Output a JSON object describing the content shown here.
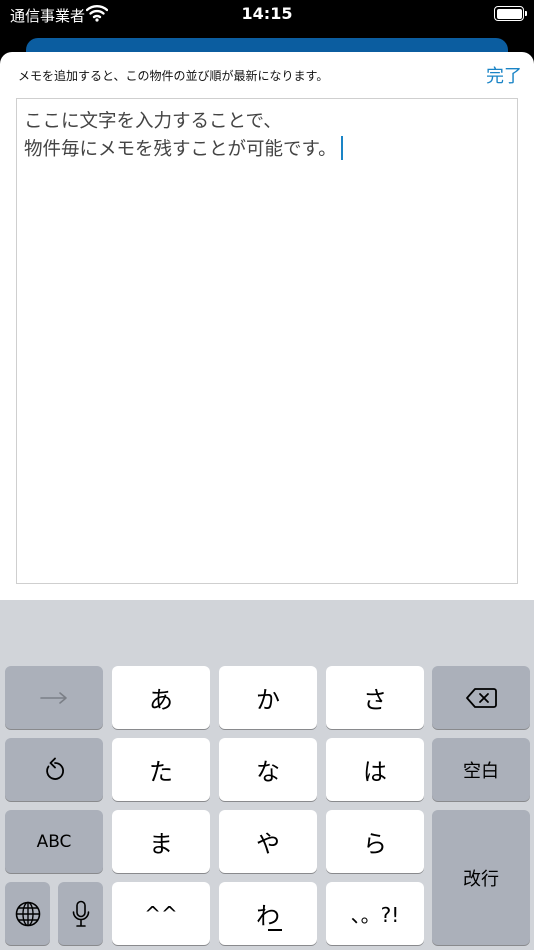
{
  "status_bar": {
    "carrier": "通信事業者",
    "time": "14:15"
  },
  "sheet": {
    "note": "メモを追加すると、この物件の並び順が最新になります。",
    "done_label": "完了",
    "memo_lines": [
      "ここに文字を入力することで、",
      "物件毎にメモを残すことが可能です。"
    ]
  },
  "keyboard": {
    "keys": {
      "a": "あ",
      "ka": "か",
      "sa": "さ",
      "ta": "た",
      "na": "な",
      "ha": "は",
      "ma": "ま",
      "ya": "や",
      "ra": "ら",
      "emoticon": "^^",
      "wa": "わ",
      "punct": "、。?!",
      "space": "空白",
      "abc": "ABC",
      "return": "改行"
    }
  },
  "colors": {
    "accent": "#1a84c6",
    "sheet_behind": "#0b5da0",
    "keyboard_bg": "#d1d4d9",
    "key_dark": "#abb0ba"
  }
}
